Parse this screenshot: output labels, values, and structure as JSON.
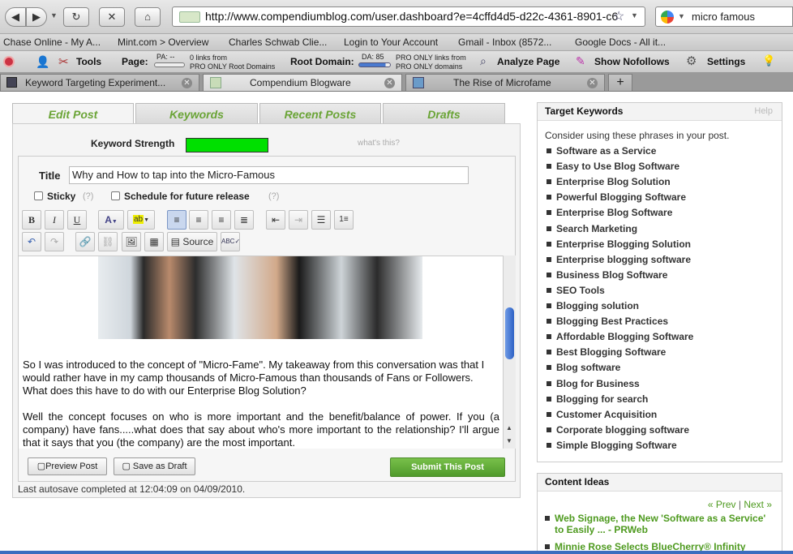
{
  "browser": {
    "url": "http://www.compendiumblog.com/user.dashboard?e=4cffd4d5-d22c-4361-8901-c6",
    "search": "micro famous",
    "bookmarks": [
      "Chase Online - My A...",
      "Mint.com > Overview",
      "Charles Schwab Clie...",
      "Login to Your Account",
      "Gmail - Inbox (8572...",
      "Google Docs - All it..."
    ],
    "toolbar": {
      "tools": "Tools",
      "page": "Page:",
      "pa": "PA: --",
      "links_page": "0 links from",
      "pro_root": "PRO ONLY Root Domains",
      "root_domain": "Root Domain:",
      "da": "DA: 85",
      "pro_links": "PRO ONLY links from",
      "pro_domains": "PRO ONLY domains",
      "analyze": "Analyze Page",
      "nofollows": "Show Nofollows",
      "settings": "Settings"
    },
    "tabs": [
      "Keyword Targeting Experiment...",
      "Compendium Blogware",
      "The Rise of Microfame"
    ]
  },
  "editor_tabs": [
    "Edit Post",
    "Keywords",
    "Recent Posts",
    "Drafts"
  ],
  "keyword_strength": {
    "label": "Keyword Strength",
    "whats_this": "what's this?",
    "bar_color": "#00e000"
  },
  "post": {
    "title_label": "Title",
    "title": "Why and How to tap into the Micro-Famous",
    "sticky": "Sticky",
    "sticky_help": "(?)",
    "schedule": "Schedule for future release",
    "schedule_help": "(?)",
    "source": "Source",
    "para1": "So I was introduced to the concept of \"Micro-Fame\".  My takeaway from this conversation was that I would rather have in my camp thousands of Micro-Famous than thousands of Fans or Followers. What does this have to do with our Enterprise Blog Solution?",
    "para2": "Well the concept focuses on who is more important and the benefit/balance of power.    If you (a company) have fans.....what does that say about who's more important to the relationship?   I'll argue that it says that you (the company) are the most important.",
    "preview": "Preview Post",
    "save_draft": "Save as Draft",
    "submit": "Submit This Post",
    "autosave": "Last autosave completed at 12:04:09 on 04/09/2010."
  },
  "target_keywords": {
    "title": "Target Keywords",
    "help": "Help",
    "intro": "Consider using these phrases in your post.",
    "items": [
      "Software as a Service",
      "Easy to Use Blog Software",
      "Enterprise Blog Solution",
      "Powerful Blogging Software",
      "Enterprise Blog Software",
      "Search Marketing",
      "Enterprise Blogging Solution",
      "Enterprise blogging software",
      "Business Blog Software",
      "SEO Tools",
      "Blogging solution",
      "Blogging Best Practices",
      "Affordable Blogging Software",
      "Best Blogging Software",
      "Blog software",
      "Blog for Business",
      "Blogging for search",
      "Customer Acquisition",
      "Corporate blogging software",
      "Simple Blogging Software"
    ]
  },
  "content_ideas": {
    "title": "Content Ideas",
    "prev": "« Prev",
    "sep": "|",
    "next": "Next »",
    "items": [
      "Web Signage, the New 'Software as a Service' to Easily ... - PRWeb",
      "Minnie Rose Selects BlueCherry® Infinity"
    ]
  },
  "colors": {
    "accent_green": "#6aa436",
    "link_green": "#4e9a1f"
  }
}
